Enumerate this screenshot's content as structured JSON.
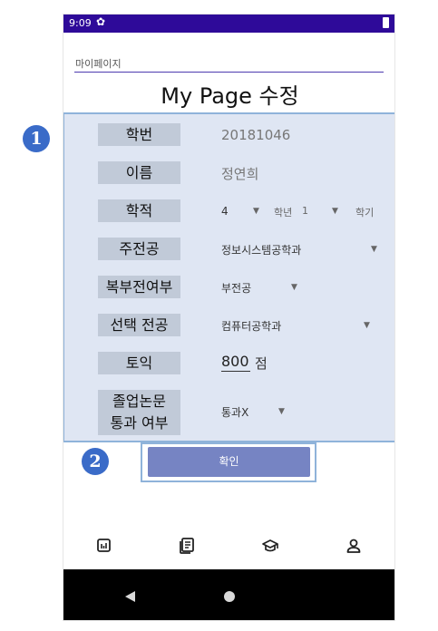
{
  "status_bar": {
    "time": "9:09",
    "settings_icon": "gear-icon",
    "battery_icon": "battery-icon"
  },
  "header": {
    "mypage_field_value": "마이페이지",
    "title": "My Page 수정"
  },
  "badges": {
    "one": "1",
    "two": "2"
  },
  "form": {
    "student_id": {
      "label": "학번",
      "value": "20181046"
    },
    "name": {
      "label": "이름",
      "value": "정연희"
    },
    "academic": {
      "label": "학적",
      "year": "4",
      "year_unit": "학년",
      "semester": "1",
      "semester_unit": "학기"
    },
    "major": {
      "label": "주전공",
      "value": "정보시스템공학과"
    },
    "double_major": {
      "label": "복부전여부",
      "value": "부전공"
    },
    "elective_major": {
      "label": "선택 전공",
      "value": "컴퓨터공학과"
    },
    "toeic": {
      "label": "토익",
      "value": "800",
      "unit": "점"
    },
    "thesis": {
      "label_line1": "졸업논문",
      "label_line2": "통과 여부",
      "value": "통과X"
    }
  },
  "confirm_label": "확인",
  "bottom_nav": [
    "chart-icon",
    "document-list-icon",
    "graduation-cap-icon",
    "person-icon"
  ],
  "colors": {
    "status_bar": "#2e0a99",
    "panel_bg": "#dfe6f3",
    "panel_border": "#8fb3da",
    "label_bg": "#c1cad8",
    "confirm_btn": "#7684c3",
    "badge": "#3a6bc8"
  }
}
